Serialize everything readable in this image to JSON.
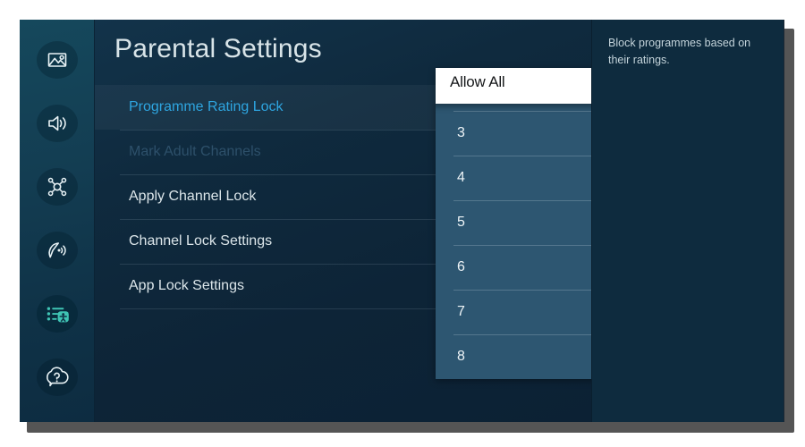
{
  "page": {
    "title": "Parental Settings"
  },
  "sidebar": {
    "items": [
      {
        "icon": "picture-icon",
        "label": "Picture",
        "active": false
      },
      {
        "icon": "sound-icon",
        "label": "Sound",
        "active": false
      },
      {
        "icon": "connection-icon",
        "label": "Connection",
        "active": false
      },
      {
        "icon": "broadcasting-icon",
        "label": "Broadcasting",
        "active": false
      },
      {
        "icon": "general-privacy-icon",
        "label": "General & Privacy",
        "active": true
      },
      {
        "icon": "support-icon",
        "label": "Support",
        "active": false
      }
    ]
  },
  "menu": {
    "items": [
      {
        "label": "Programme Rating Lock",
        "state": "selected"
      },
      {
        "label": "Mark Adult Channels",
        "state": "disabled"
      },
      {
        "label": "Apply Channel Lock",
        "state": "normal"
      },
      {
        "label": "Channel Lock Settings",
        "state": "normal"
      },
      {
        "label": "App Lock Settings",
        "state": "normal"
      }
    ]
  },
  "dropdown": {
    "selected_label": "Allow All",
    "selected_icon": "check-circle-icon",
    "options": [
      "3",
      "4",
      "5",
      "6",
      "7",
      "8"
    ]
  },
  "description": {
    "text": "Block programmes based on their ratings."
  },
  "colors": {
    "accent_blue": "#2ea5e0",
    "accent_teal": "#3fc4b4",
    "check_blue": "#1ba1e2",
    "rail_bg": "#133d52",
    "content_bg": "#0d2437",
    "dropdown_bg": "#2d5671",
    "desc_bg": "#0e2b3e"
  }
}
